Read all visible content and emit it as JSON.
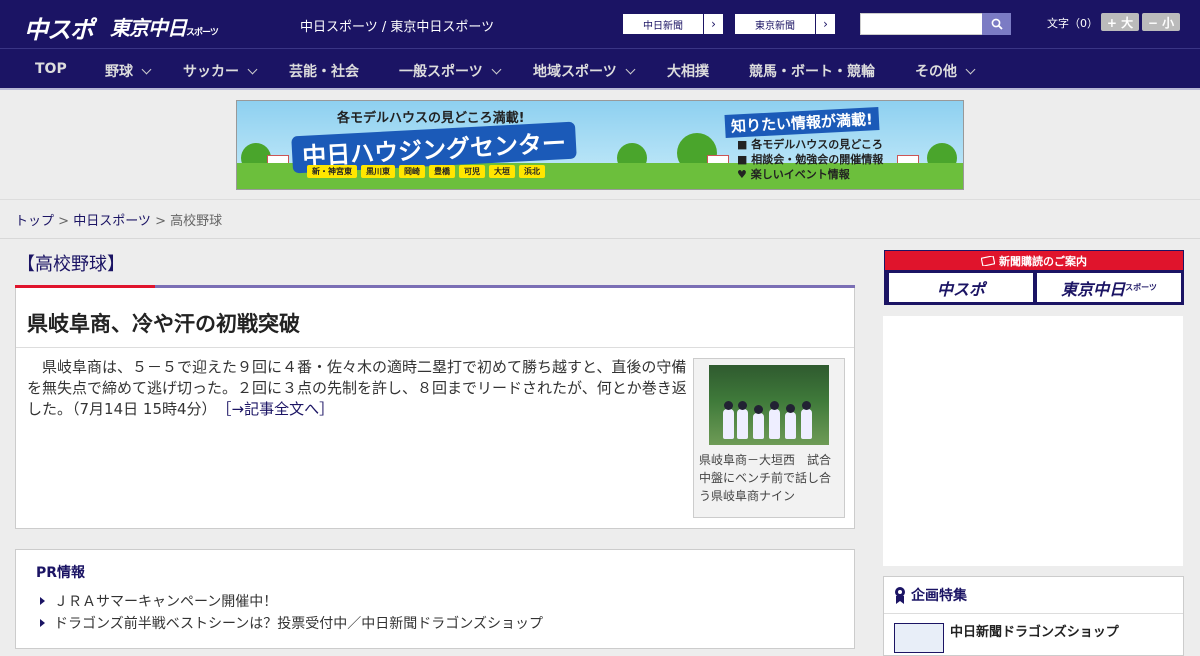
{
  "header": {
    "logo_chuspo": "中スポ",
    "logo_tokyo": "東京中日",
    "logo_tokyo_small": "スポーツ",
    "site_title": "中日スポーツ / 東京中日スポーツ",
    "chunichi_btn": "中日新聞",
    "tokyo_btn": "東京新聞",
    "search_placeholder": "",
    "fontsize_label": "文字（0）",
    "font_larger": "+ 大",
    "font_smaller": "− 小"
  },
  "nav": {
    "items": [
      "TOP",
      "野球",
      "サッカー",
      "芸能・社会",
      "一般スポーツ",
      "地域スポーツ",
      "大相撲",
      "競馬・ボート・競輪",
      "その他"
    ]
  },
  "banner": {
    "headline": "各モデルハウスの見どころ満載!",
    "main": "中日ハウジングセンター",
    "towns": [
      "新・神宮東",
      "黒川東",
      "岡崎",
      "豊橋",
      "可児",
      "大垣",
      "浜北"
    ],
    "side_head": "知りたい情報が満載!",
    "side_items": [
      "各モデルハウスの見どころ",
      "相談会・勉強会の開催情報",
      "楽しいイベント情報"
    ]
  },
  "breadcrumb": {
    "top": "トップ",
    "sep": " > ",
    "section": "中日スポーツ",
    "current": "高校野球"
  },
  "article": {
    "category": "【高校野球】",
    "title": "県岐阜商、冷や汗の初戦突破",
    "body": "県岐阜商は、５－５で迎えた９回に４番・佐々木の適時二塁打で初めて勝ち越すと、直後の守備を無失点で締めて逃げ切った。２回に３点の先制を許し、８回までリードされたが、何とか巻き返した。（7月14日 15時4分）",
    "more_link": "［→記事全文へ］",
    "photo_caption": "県岐阜商－大垣西　試合中盤にベンチ前で話し合う県岐阜商ナイン"
  },
  "pr": {
    "title": "PR情報",
    "items": [
      "ＪＲＡサマーキャンペーン開催中！",
      "ドラゴンズ前半戦ベストシーンは？投票受付中／中日新聞ドラゴンズショップ"
    ]
  },
  "sidebar": {
    "subscribe_head": "新聞購読のご案内",
    "subscribe_chuspo": "中スポ",
    "subscribe_tokyo": "東京中日",
    "subscribe_tokyo_small": "スポーツ",
    "feature_title": "企画特集",
    "feature_item": "中日新聞ドラゴンズショップ"
  },
  "colors": {
    "brand_navy": "#1b1464",
    "accent_red": "#e0142c",
    "accent_purple": "#7b6fb5"
  }
}
